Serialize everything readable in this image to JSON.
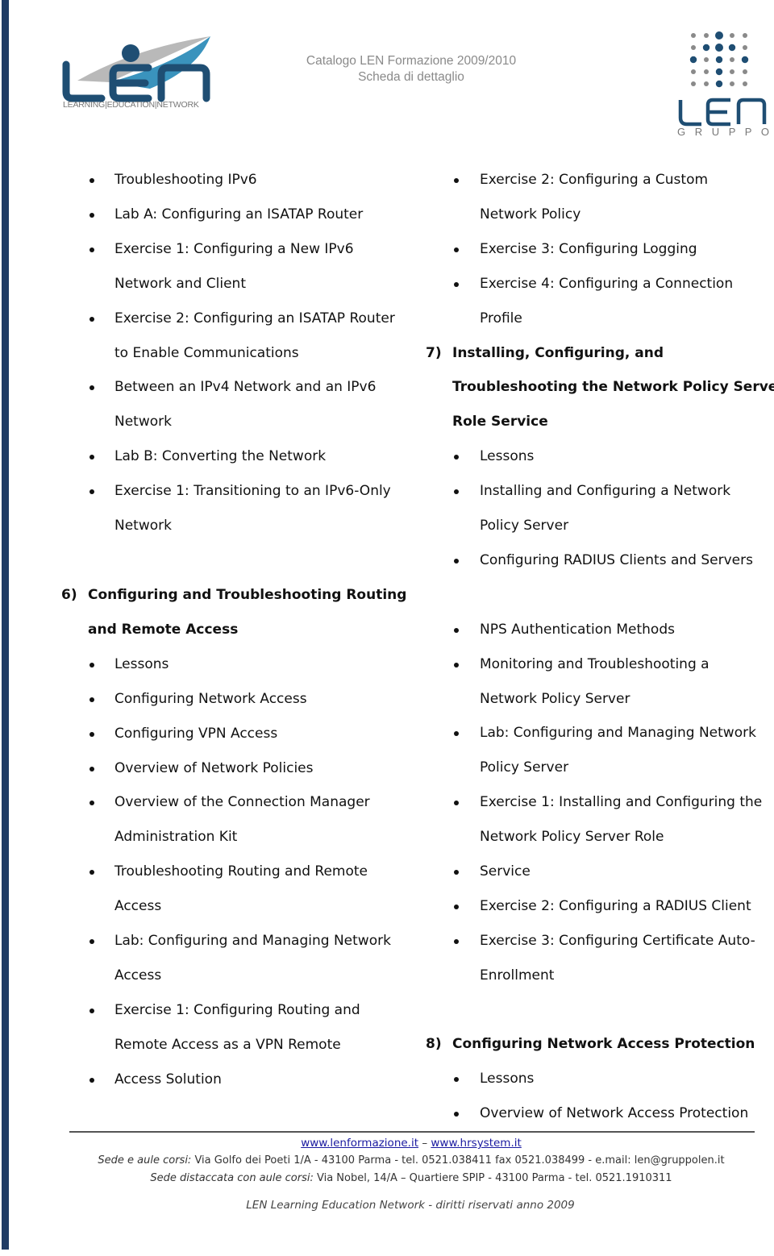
{
  "header": {
    "title_line1": "Catalogo LEN Formazione 2009/2010",
    "title_line2": "Scheda di dettaglio",
    "logo_left_caption": "LEARNING|EDUCATION|NETWORK",
    "logo_left_letters": "LEN",
    "logo_right_letters": "LEN",
    "logo_right_caption": "G R U P P O",
    "brand_color": "#1f4e73",
    "accent_color": "#2a8ab8"
  },
  "left_column": {
    "items": [
      {
        "type": "bullet",
        "text": "Troubleshooting IPv6"
      },
      {
        "type": "bullet",
        "text": "Lab A: Configuring an ISATAP Router"
      },
      {
        "type": "bullet",
        "text": "Exercise 1: Configuring a New IPv6"
      },
      {
        "type": "cont",
        "text": "Network and Client"
      },
      {
        "type": "bullet",
        "text": "Exercise 2: Configuring an ISATAP Router"
      },
      {
        "type": "cont",
        "text": "to Enable Communications"
      },
      {
        "type": "bullet",
        "text": "Between an IPv4 Network and an IPv6"
      },
      {
        "type": "cont",
        "text": "Network"
      },
      {
        "type": "bullet",
        "text": "Lab B: Converting the Network"
      },
      {
        "type": "bullet",
        "text": "Exercise 1: Transitioning to an IPv6-Only"
      },
      {
        "type": "cont",
        "text": "Network"
      }
    ],
    "section6": {
      "number": "6)",
      "title_line1": "Configuring and Troubleshooting Routing",
      "title_line2": "and Remote Access",
      "items": [
        {
          "type": "bullet",
          "text": "Lessons"
        },
        {
          "type": "bullet",
          "text": "Configuring Network Access"
        },
        {
          "type": "bullet",
          "text": "Configuring VPN Access"
        },
        {
          "type": "bullet",
          "text": "Overview of Network Policies"
        },
        {
          "type": "bullet",
          "text": "Overview of the Connection Manager"
        },
        {
          "type": "cont",
          "text": "Administration Kit"
        },
        {
          "type": "bullet",
          "text": "Troubleshooting Routing and Remote"
        },
        {
          "type": "cont",
          "text": "Access"
        },
        {
          "type": "bullet",
          "text": "Lab: Configuring and Managing Network"
        },
        {
          "type": "cont",
          "text": "Access"
        },
        {
          "type": "bullet",
          "text": "Exercise 1: Configuring Routing and"
        },
        {
          "type": "cont",
          "text": "Remote Access as a VPN Remote"
        },
        {
          "type": "bullet",
          "text": "Access Solution"
        }
      ]
    }
  },
  "right_column": {
    "items_top": [
      {
        "type": "bullet",
        "text": "Exercise 2: Configuring a Custom"
      },
      {
        "type": "cont",
        "text": "Network Policy"
      },
      {
        "type": "bullet",
        "text": "Exercise 3: Configuring Logging"
      },
      {
        "type": "bullet",
        "text": "Exercise 4: Configuring a Connection"
      },
      {
        "type": "cont",
        "text": "Profile"
      }
    ],
    "section7": {
      "number": "7)",
      "title_line1": "Installing, Configuring, and",
      "title_line2": "Troubleshooting the Network Policy Server",
      "title_line3": "Role Service",
      "items": [
        {
          "type": "bullet",
          "text": "Lessons"
        },
        {
          "type": "bullet",
          "text": "Installing and Configuring a Network"
        },
        {
          "type": "cont",
          "text": "Policy Server"
        },
        {
          "type": "bullet",
          "text": "Configuring RADIUS Clients and Servers"
        },
        {
          "type": "gap",
          "text": ""
        },
        {
          "type": "bullet",
          "text": "NPS Authentication Methods"
        },
        {
          "type": "bullet",
          "text": "Monitoring and Troubleshooting a"
        },
        {
          "type": "cont",
          "text": "Network Policy Server"
        },
        {
          "type": "bullet",
          "text": "Lab: Configuring and Managing Network"
        },
        {
          "type": "cont",
          "text": "Policy Server"
        },
        {
          "type": "bullet",
          "text": "Exercise 1: Installing and Configuring the"
        },
        {
          "type": "cont",
          "text": "Network Policy Server Role"
        },
        {
          "type": "bullet",
          "text": "Service"
        },
        {
          "type": "bullet",
          "text": "Exercise 2: Configuring a RADIUS Client"
        },
        {
          "type": "bullet",
          "text": "Exercise 3: Configuring Certificate Auto-"
        },
        {
          "type": "cont",
          "text": "Enrollment"
        }
      ]
    },
    "section8": {
      "number": "8)",
      "title": "Configuring Network Access Protection",
      "items": [
        {
          "type": "bullet",
          "text": "Lessons"
        },
        {
          "type": "bullet",
          "text": "Overview of Network Access Protection"
        }
      ]
    }
  },
  "footer": {
    "link1": "www.lenformazione.it",
    "separator": " –  ",
    "link2": "www.hrsystem.it",
    "line1_label": "Sede e aule corsi:",
    "line1_text": " Via Golfo dei Poeti 1/A - 43100 Parma -  tel. 0521.038411 fax 0521.038499 - e.mail: len@gruppolen.it",
    "line2_label": "Sede distaccata con aule corsi:",
    "line2_text": " Via  Nobel, 14/A – Quartiere SPIP - 43100 Parma - tel. 0521.1910311",
    "copyright": "LEN Learning Education Network  - diritti riservati anno 2009"
  }
}
